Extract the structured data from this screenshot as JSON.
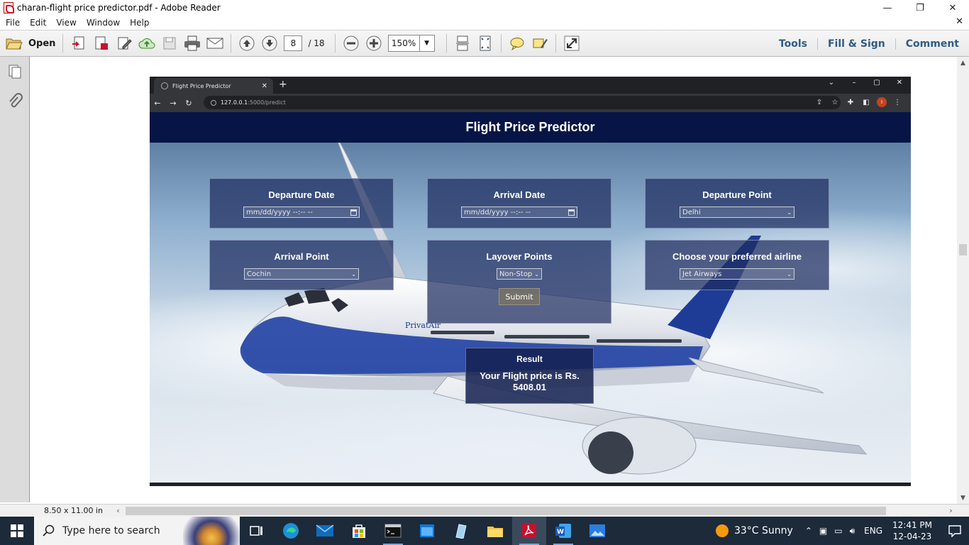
{
  "window": {
    "title": "charan-flight price predictor.pdf - Adobe Reader",
    "minimize": "—",
    "restore": "❐",
    "close": "✕"
  },
  "menu": {
    "items": [
      "File",
      "Edit",
      "View",
      "Window",
      "Help"
    ],
    "close": "✕"
  },
  "toolbar": {
    "open_label": "Open",
    "page_current": "8",
    "page_total": "/ 18",
    "zoom": "150%",
    "right_tabs": [
      "Tools",
      "Fill & Sign",
      "Comment"
    ]
  },
  "status": {
    "page_size": "8.50 x 11.00 in"
  },
  "browser": {
    "tab_title": "Flight Price Predictor",
    "tab_close": "✕",
    "new_tab": "+",
    "url_host": "127.0.0.1",
    "url_path": ":5000/predict",
    "profile_initial": "I"
  },
  "app": {
    "header": "Flight Price Predictor",
    "departure_date": {
      "label": "Departure Date",
      "placeholder": "mm/dd/yyyy --:-- --"
    },
    "arrival_date": {
      "label": "Arrival Date",
      "placeholder": "mm/dd/yyyy --:-- --"
    },
    "departure_point": {
      "label": "Departure Point",
      "value": "Delhi"
    },
    "arrival_point": {
      "label": "Arrival Point",
      "value": "Cochin"
    },
    "layover": {
      "label": "Layover Points",
      "value": "Non-Stop"
    },
    "airline": {
      "label": "Choose your preferred airline",
      "value": "Jet Airways"
    },
    "submit_label": "Submit",
    "result": {
      "title": "Result",
      "line1": "Your Flight price is Rs.",
      "line2": "5408.01"
    },
    "plane_livery": "PrivatAir"
  },
  "taskbar": {
    "search_placeholder": "Type here to search",
    "weather": "33°C  Sunny",
    "language": "ENG",
    "time": "12:41 PM",
    "date": "12-04-23"
  },
  "colors": {
    "header_bg": "#061545",
    "card_bg": "#1e2d5f",
    "acrobat_red": "#c8102e",
    "toolbar_link": "#2d5b86"
  }
}
